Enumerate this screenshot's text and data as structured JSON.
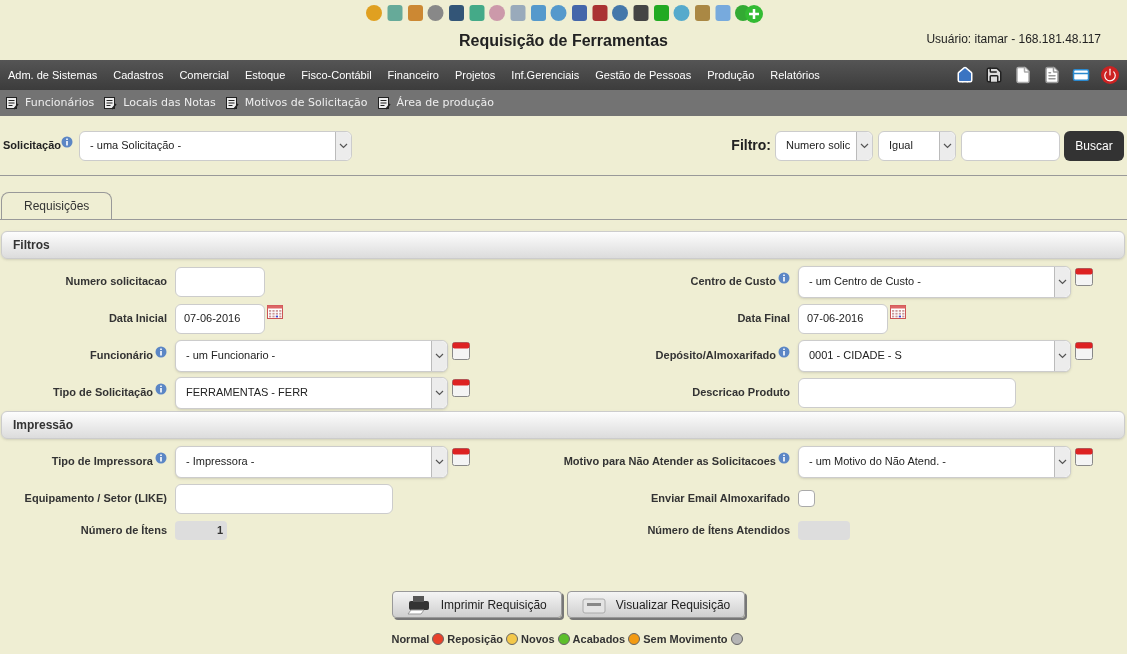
{
  "header": {
    "title": "Requisição de Ferramentas",
    "user": "Usuário: itamar - 168.181.48.117"
  },
  "menu": [
    "Adm. de Sistemas",
    "Cadastros",
    "Comercial",
    "Estoque",
    "Fisco-Contábil",
    "Financeiro",
    "Projetos",
    "Inf.Gerenciais",
    "Gestão de Pessoas",
    "Produção",
    "Relatórios"
  ],
  "submenu": [
    "Funcionários",
    "Locais das Notas",
    "Motivos de Solicitação",
    "Área de produção"
  ],
  "search_bar": {
    "label": "Solicitação",
    "select": "- uma Solicitação -",
    "filter_label": "Filtro:",
    "filter_field": "Numero solic",
    "filter_operator": "Igual",
    "button": "Buscar"
  },
  "tabs": [
    {
      "label": "Requisições",
      "selected": true
    }
  ],
  "sections": [
    {
      "title": "Filtros",
      "rows": [
        [
          {
            "label": "Numero solicitacao",
            "info": false,
            "kind": "text"
          },
          {
            "label": "Centro de Custo",
            "info": true,
            "kind": "select",
            "value": "- um Centro de Custo -",
            "add": true
          }
        ],
        [
          {
            "label": "Data Inicial",
            "info": false,
            "kind": "date",
            "value": "07-06-2016"
          },
          {
            "label": "Data Final",
            "info": false,
            "kind": "date",
            "value": "07-06-2016"
          }
        ],
        [
          {
            "label": "Funcionário",
            "info": true,
            "kind": "select",
            "value": "- um Funcionario -",
            "add": true
          },
          {
            "label": "Depósito/Almoxarifado",
            "info": true,
            "kind": "select",
            "value": "0001 - CIDADE - S",
            "add": true
          }
        ],
        [
          {
            "label": "Tipo de Solicitação",
            "info": true,
            "kind": "select",
            "value": "FERRAMENTAS - FERR",
            "add": true
          },
          {
            "label": "Descricao Produto",
            "info": false,
            "kind": "wide"
          }
        ]
      ]
    },
    {
      "title": "Impressão",
      "rows": [
        [
          {
            "label": "Tipo de Impressora",
            "info": true,
            "kind": "select",
            "value": "- Impressora -",
            "add": true
          },
          {
            "label": "Motivo para Não Atender as Solicitacoes",
            "info": true,
            "kind": "select",
            "value": "- um Motivo do Não Atend. -",
            "add": true
          }
        ],
        [
          {
            "label": "Equipamento / Setor (LIKE)",
            "info": false,
            "kind": "wide"
          },
          {
            "label": "Enviar Email Almoxarifado",
            "info": false,
            "kind": "checkbox",
            "checked": false
          }
        ],
        [
          {
            "label": "Número de Ítens",
            "info": false,
            "kind": "readonly",
            "value": "1"
          },
          {
            "label": "Número de Ítens Atendidos",
            "info": false,
            "kind": "readonly"
          }
        ]
      ]
    }
  ],
  "buttons": [
    {
      "label": "Imprimir Requisição",
      "kind": "print"
    },
    {
      "label": "Visualizar Requisição",
      "kind": "preview"
    }
  ],
  "legend": [
    {
      "label": "Normal",
      "color": "#e8412a"
    },
    {
      "label": "Reposição",
      "color": "#f3c84a"
    },
    {
      "label": "Novos",
      "color": "#5cbf2a"
    },
    {
      "label": "Acabados",
      "color": "#f29a12"
    },
    {
      "label": "Sem Movimento",
      "color": "#b5b5b5"
    }
  ]
}
